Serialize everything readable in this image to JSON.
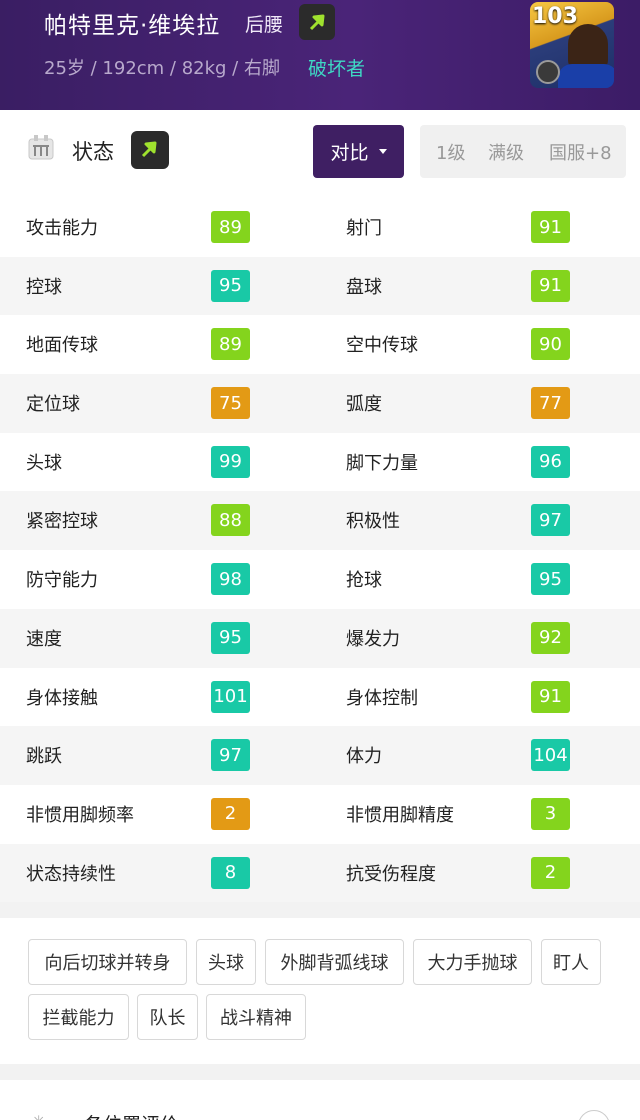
{
  "player": {
    "name": "帕特里克·维埃拉",
    "position": "后腰",
    "info": "25岁 / 192cm / 82kg / 右脚",
    "play_style": "破坏者",
    "card_rating": "103",
    "trend_icon": "arrow-up-right-icon"
  },
  "status": {
    "title": "状态",
    "compare_label": "对比",
    "levels": [
      "1级",
      "满级",
      "国服+8"
    ]
  },
  "colors": {
    "header_bg": "#4a2478",
    "accent_teal": "#3ed8c4",
    "green": "#84d41d",
    "teal": "#19c9a6",
    "orange": "#e39a15"
  },
  "stats": [
    {
      "left": {
        "label": "攻击能力",
        "value": "89",
        "color": "green"
      },
      "right": {
        "label": "射门",
        "value": "91",
        "color": "green"
      }
    },
    {
      "left": {
        "label": "控球",
        "value": "95",
        "color": "teal"
      },
      "right": {
        "label": "盘球",
        "value": "91",
        "color": "green"
      }
    },
    {
      "left": {
        "label": "地面传球",
        "value": "89",
        "color": "green"
      },
      "right": {
        "label": "空中传球",
        "value": "90",
        "color": "green"
      }
    },
    {
      "left": {
        "label": "定位球",
        "value": "75",
        "color": "orange"
      },
      "right": {
        "label": "弧度",
        "value": "77",
        "color": "orange"
      }
    },
    {
      "left": {
        "label": "头球",
        "value": "99",
        "color": "teal"
      },
      "right": {
        "label": "脚下力量",
        "value": "96",
        "color": "teal"
      }
    },
    {
      "left": {
        "label": "紧密控球",
        "value": "88",
        "color": "green"
      },
      "right": {
        "label": "积极性",
        "value": "97",
        "color": "teal"
      }
    },
    {
      "left": {
        "label": "防守能力",
        "value": "98",
        "color": "teal"
      },
      "right": {
        "label": "抢球",
        "value": "95",
        "color": "teal"
      }
    },
    {
      "left": {
        "label": "速度",
        "value": "95",
        "color": "teal"
      },
      "right": {
        "label": "爆发力",
        "value": "92",
        "color": "green"
      }
    },
    {
      "left": {
        "label": "身体接触",
        "value": "101",
        "color": "teal"
      },
      "right": {
        "label": "身体控制",
        "value": "91",
        "color": "green"
      }
    },
    {
      "left": {
        "label": "跳跃",
        "value": "97",
        "color": "teal"
      },
      "right": {
        "label": "体力",
        "value": "104",
        "color": "teal"
      }
    },
    {
      "left": {
        "label": "非惯用脚频率",
        "value": "2",
        "color": "orange"
      },
      "right": {
        "label": "非惯用脚精度",
        "value": "3",
        "color": "green"
      }
    },
    {
      "left": {
        "label": "状态持续性",
        "value": "8",
        "color": "teal"
      },
      "right": {
        "label": "抗受伤程度",
        "value": "2",
        "color": "green"
      }
    }
  ],
  "skills": [
    "向后切球并转身",
    "头球",
    "外脚背弧线球",
    "大力手抛球",
    "盯人",
    "拦截能力",
    "队长",
    "战斗精神"
  ],
  "bottom": {
    "title": "各位置评价"
  }
}
